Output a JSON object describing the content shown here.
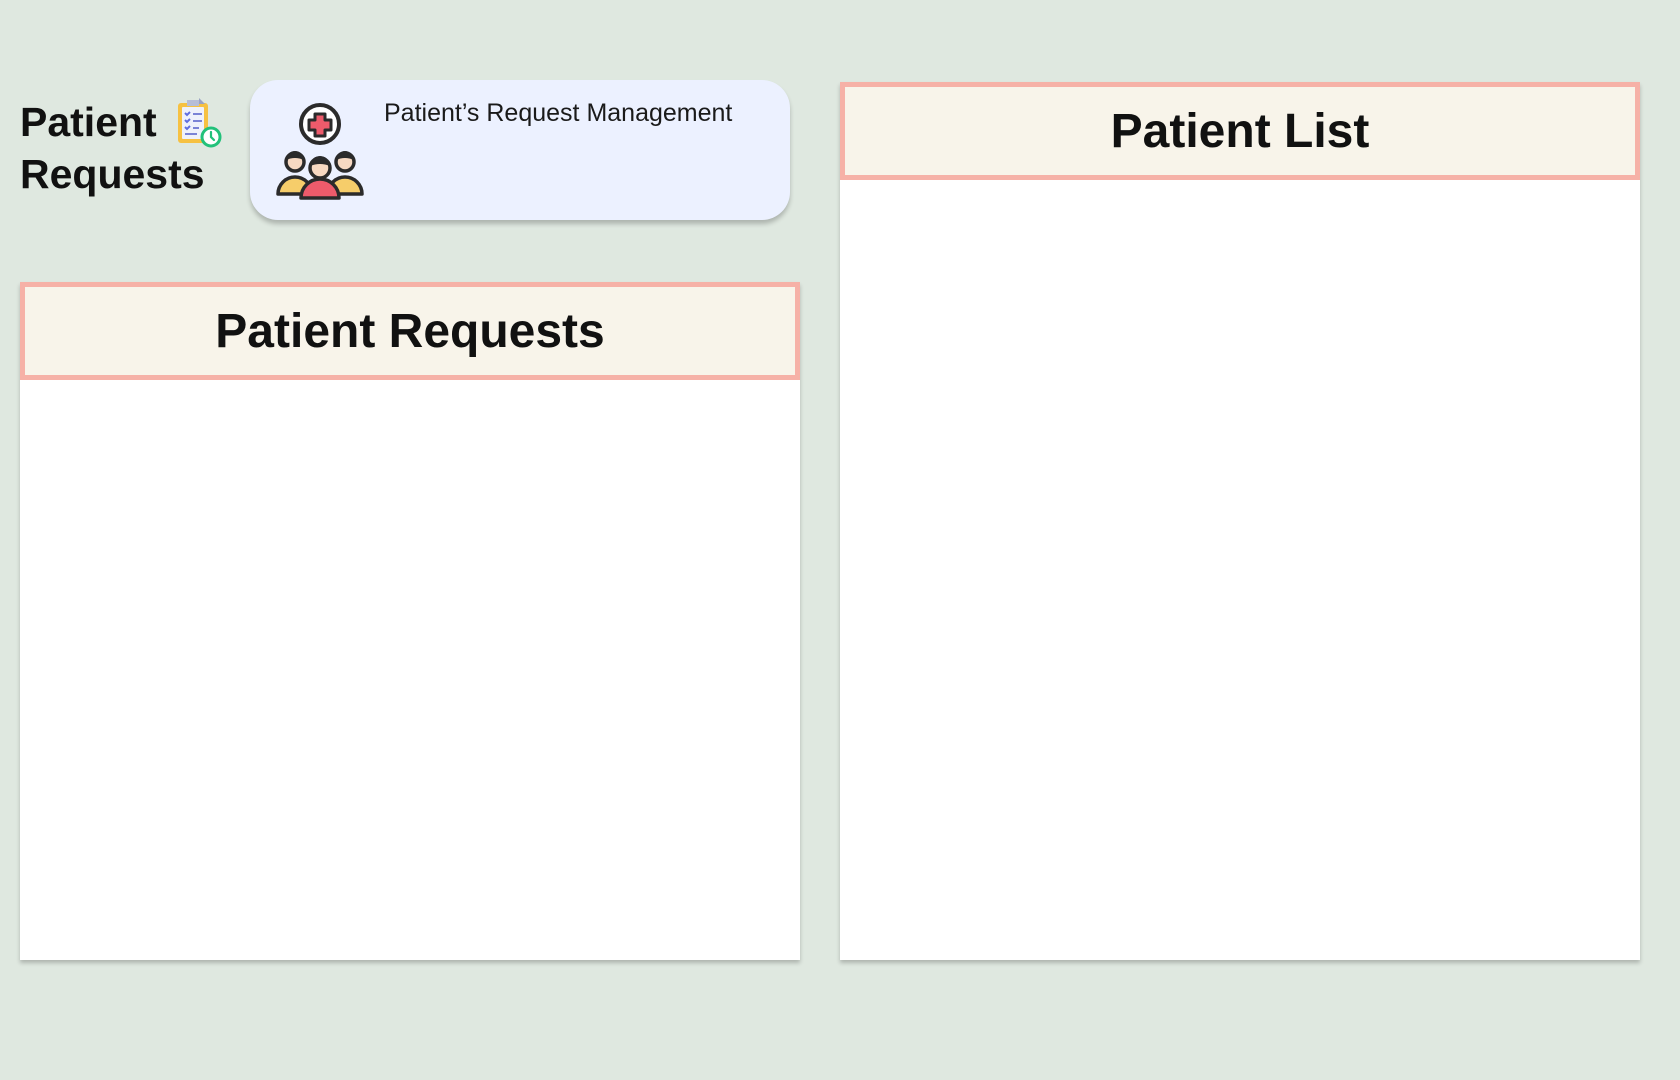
{
  "page_title": {
    "line1": "Patient",
    "line2": "Requests"
  },
  "icons": {
    "title_icon": "clipboard-checklist-clock-icon",
    "card_icon": "patients-medical-cross-icon"
  },
  "info_card": {
    "text": "Patient’s Request Management"
  },
  "panels": {
    "requests": {
      "title": "Patient Requests"
    },
    "list": {
      "title": "Patient List"
    }
  },
  "colors": {
    "background": "#dfe8e0",
    "card_background": "#ecf1ff",
    "panel_header_background": "#f8f4ea",
    "panel_header_border": "#f6b1a7",
    "panel_body": "#ffffff"
  }
}
